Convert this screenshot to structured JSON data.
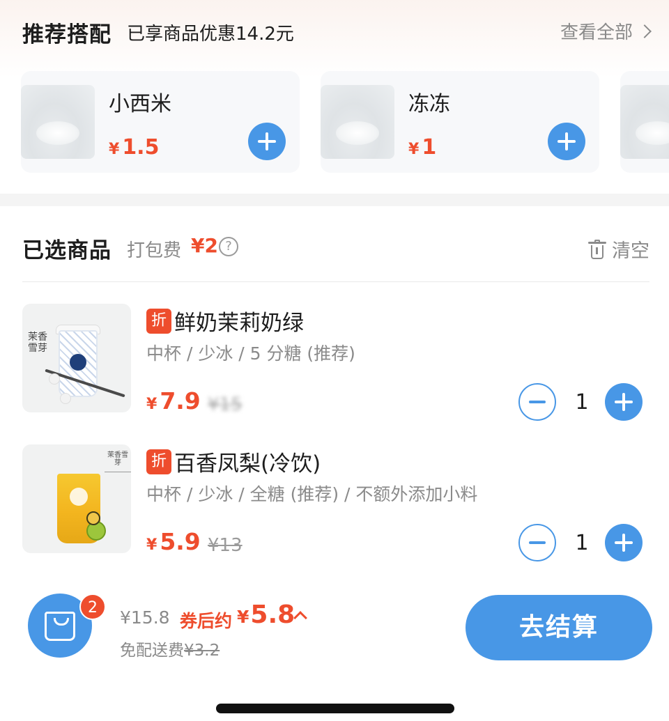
{
  "recommend": {
    "title": "推荐搭配",
    "discount_text": "已享商品优惠14.2元",
    "view_all": "查看全部",
    "items": [
      {
        "name": "小西米",
        "currency": "¥",
        "price": "1.5"
      },
      {
        "name": "冻冻",
        "currency": "¥",
        "price": "1"
      }
    ]
  },
  "cart": {
    "title": "已选商品",
    "pack_fee_label": "打包费",
    "pack_fee": "¥2",
    "help_symbol": "?",
    "clear_label": "清空",
    "items": [
      {
        "tag": "折",
        "name": "鲜奶茉莉奶绿",
        "spec": "中杯 / 少冰 / 5 分糖 (推荐)",
        "currency": "¥",
        "price": "7.9",
        "orig_price": "¥15",
        "quantity": "1",
        "image_text": "茉香雪芽"
      },
      {
        "tag": "折",
        "name": "百香凤梨(冷饮)",
        "spec": "中杯 / 少冰 / 全糖 (推荐) / 不额外添加小料",
        "currency": "¥",
        "price": "5.9",
        "orig_price": "¥13",
        "quantity": "1",
        "image_text": "茉香雪芽"
      }
    ]
  },
  "footer": {
    "badge_count": "2",
    "total_original": "¥15.8",
    "after_coupon_label": "券后约",
    "after_coupon_currency": "¥",
    "after_coupon_price": "5.8",
    "delivery_label": "免配送费",
    "delivery_original": "¥3.2",
    "checkout_label": "去结算"
  },
  "colors": {
    "accent_blue": "#4897e6",
    "price_red": "#ee4d2d"
  }
}
